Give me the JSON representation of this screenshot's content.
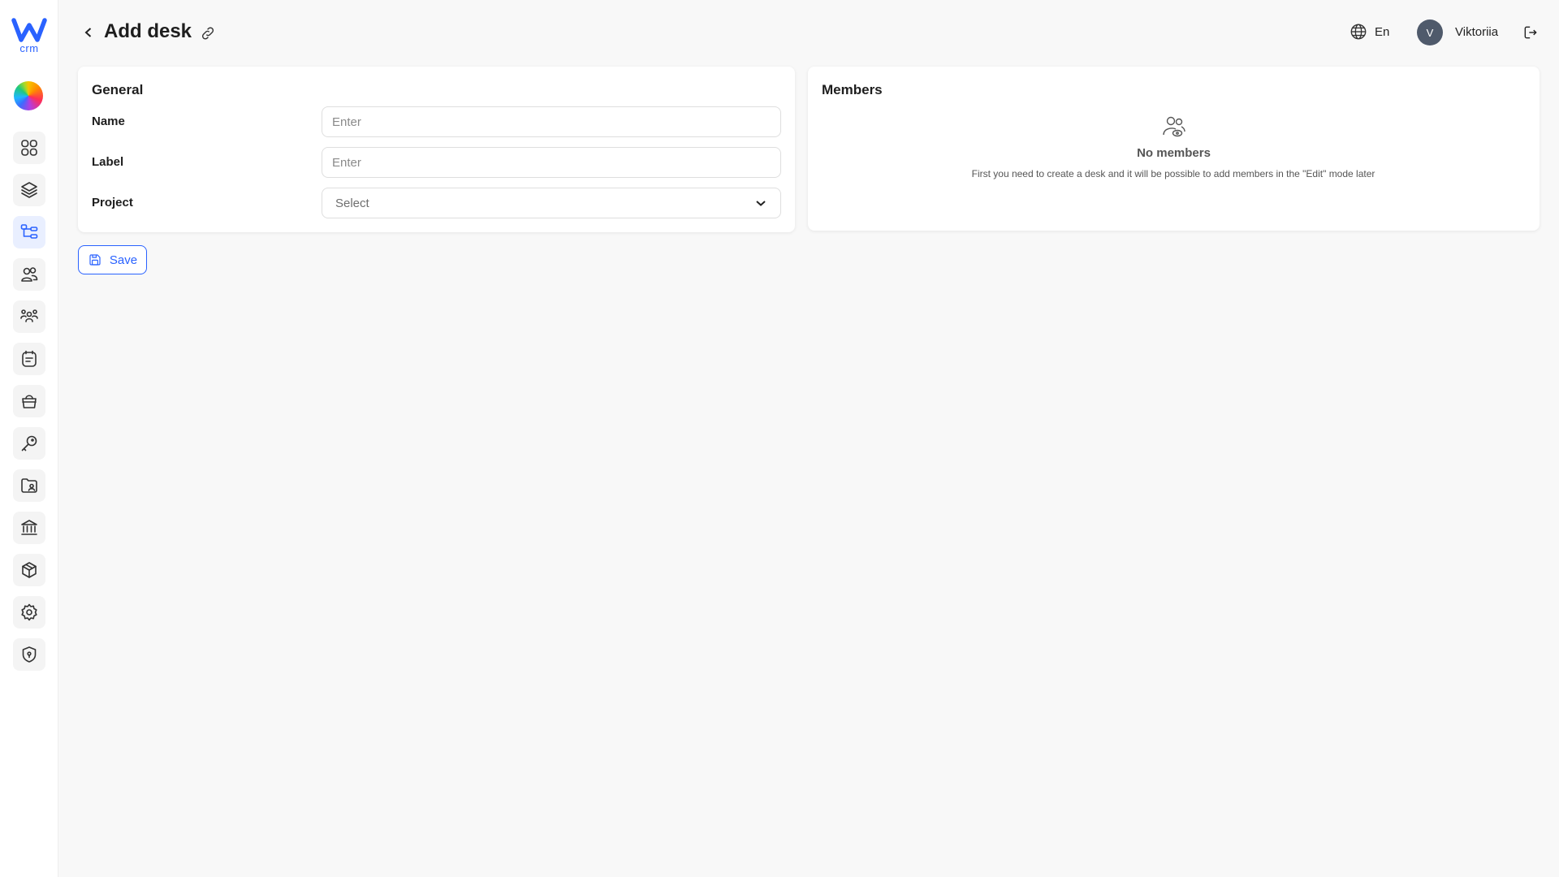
{
  "brand": {
    "logo_letter": "W",
    "logo_sub": "crm",
    "accent_color": "#2a62ff"
  },
  "sidebar": {
    "items": [
      {
        "icon": "dashboard-grid-icon",
        "active": false
      },
      {
        "icon": "layers-icon",
        "active": false
      },
      {
        "icon": "hierarchy-icon",
        "active": true
      },
      {
        "icon": "users-icon",
        "active": false
      },
      {
        "icon": "team-icon",
        "active": false
      },
      {
        "icon": "notes-icon",
        "active": false
      },
      {
        "icon": "basket-icon",
        "active": false
      },
      {
        "icon": "key-icon",
        "active": false
      },
      {
        "icon": "folder-user-icon",
        "active": false
      },
      {
        "icon": "bank-icon",
        "active": false
      },
      {
        "icon": "box-icon",
        "active": false
      },
      {
        "icon": "gear-icon",
        "active": false
      },
      {
        "icon": "shield-icon",
        "active": false
      }
    ]
  },
  "header": {
    "title": "Add desk",
    "language": "En",
    "user": {
      "initial": "V",
      "name": "Viktoriia"
    }
  },
  "general": {
    "title": "General",
    "fields": {
      "name": {
        "label": "Name",
        "placeholder": "Enter",
        "value": ""
      },
      "label": {
        "label": "Label",
        "placeholder": "Enter",
        "value": ""
      },
      "project": {
        "label": "Project",
        "placeholder": "Select"
      }
    }
  },
  "members": {
    "title": "Members",
    "empty_title": "No members",
    "empty_desc": "First you need to create a desk and it will be possible to add  members in the \"Edit\" mode later"
  },
  "actions": {
    "save_label": "Save"
  }
}
